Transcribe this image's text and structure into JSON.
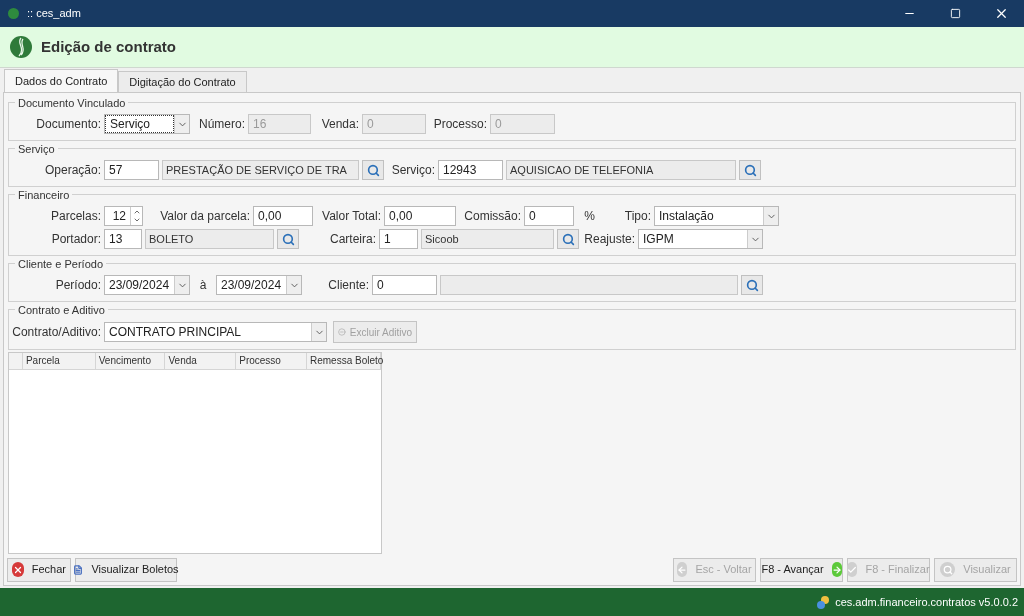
{
  "window": {
    "title": ":: ces_adm"
  },
  "header": {
    "title": "Edição de contrato"
  },
  "tabs": [
    {
      "label": "Dados do Contrato",
      "selected": true
    },
    {
      "label": "Digitação do Contrato",
      "selected": false
    }
  ],
  "sections": [
    {
      "title": "Documento Vinculado",
      "rows": [
        [
          {
            "kind": "label",
            "text": "Documento:"
          },
          {
            "kind": "select",
            "value": "Serviço",
            "focused": true
          },
          {
            "kind": "label",
            "text": "Número:"
          },
          {
            "kind": "input",
            "value": "16",
            "disabled": true
          },
          {
            "kind": "label",
            "text": "Venda:"
          },
          {
            "kind": "input",
            "value": "0",
            "disabled": true
          },
          {
            "kind": "label",
            "text": "Processo:"
          },
          {
            "kind": "input",
            "value": "0",
            "disabled": true
          }
        ]
      ]
    },
    {
      "title": "Serviço",
      "rows": [
        [
          {
            "kind": "label",
            "text": "Operação:"
          },
          {
            "kind": "input",
            "value": "57",
            "disabled": false
          },
          {
            "kind": "display",
            "value": "PRESTAÇÃO DE SERVIÇO DE TRA"
          },
          {
            "kind": "lookup"
          },
          {
            "kind": "label",
            "text": "Serviço:"
          },
          {
            "kind": "input",
            "value": "12943",
            "disabled": false
          },
          {
            "kind": "display",
            "value": "AQUISICAO DE TELEFONIA"
          },
          {
            "kind": "lookup"
          }
        ]
      ]
    },
    {
      "title": "Financeiro",
      "rows": [
        [
          {
            "kind": "label",
            "text": "Parcelas:"
          },
          {
            "kind": "spin",
            "value": "12"
          },
          {
            "kind": "label",
            "text": "Valor da parcela:"
          },
          {
            "kind": "input",
            "value": "0,00",
            "disabled": false
          },
          {
            "kind": "label",
            "text": "Valor Total:"
          },
          {
            "kind": "input",
            "value": "0,00",
            "disabled": false
          },
          {
            "kind": "label",
            "text": "Comissão:"
          },
          {
            "kind": "input",
            "value": "0",
            "disabled": false
          },
          {
            "kind": "unit",
            "text": "%"
          },
          {
            "kind": "label",
            "text": "Tipo:"
          },
          {
            "kind": "select",
            "value": "Instalação",
            "focused": false
          }
        ],
        [
          {
            "kind": "label",
            "text": "Portador:"
          },
          {
            "kind": "input",
            "value": "13",
            "disabled": false
          },
          {
            "kind": "display",
            "value": "BOLETO"
          },
          {
            "kind": "lookup"
          },
          {
            "kind": "label",
            "text": "Carteira:"
          },
          {
            "kind": "input",
            "value": "1",
            "disabled": false
          },
          {
            "kind": "display",
            "value": "Sicoob"
          },
          {
            "kind": "lookup"
          },
          {
            "kind": "label",
            "text": "Reajuste:"
          },
          {
            "kind": "select",
            "value": "IGPM",
            "focused": false
          }
        ]
      ]
    },
    {
      "title": "Cliente e Período",
      "rows": [
        [
          {
            "kind": "label",
            "text": "Período:"
          },
          {
            "kind": "date",
            "value": "23/09/2024"
          },
          {
            "kind": "unit",
            "text": "à"
          },
          {
            "kind": "date",
            "value": "23/09/2024"
          },
          {
            "kind": "label",
            "text": "Cliente:"
          },
          {
            "kind": "input",
            "value": "0",
            "disabled": false
          },
          {
            "kind": "display"
          },
          {
            "kind": "lookup"
          }
        ]
      ]
    },
    {
      "title": "Contrato e Aditivo",
      "rows": [
        [
          {
            "kind": "label",
            "text": "Contrato/Aditivo:"
          },
          {
            "kind": "select",
            "value": "CONTRATO PRINCIPAL",
            "focused": false
          },
          {
            "kind": "button",
            "label": "Excluir Aditivo",
            "disabled": true
          }
        ]
      ]
    }
  ],
  "table": {
    "columns": [
      "Parcela",
      "Vencimento",
      "Venda",
      "Processo",
      "Remessa Boleto"
    ]
  },
  "footer_left": [
    {
      "kind": "close",
      "label": "Fechar",
      "disabled": false
    },
    {
      "kind": "list",
      "label": "Visualizar Boletos",
      "disabled": false
    }
  ],
  "footer_right": [
    {
      "kind": "back",
      "label": "Esc - Voltar",
      "disabled": true
    },
    {
      "kind": "next",
      "label": "F8 - Avançar",
      "disabled": false
    },
    {
      "kind": "finish",
      "label": "F8 - Finalizar",
      "disabled": true
    },
    {
      "kind": "preview",
      "label": "Visualizar",
      "disabled": true
    }
  ],
  "status_bar": {
    "text": "ces.adm.financeiro.contratos v5.0.0.2"
  }
}
